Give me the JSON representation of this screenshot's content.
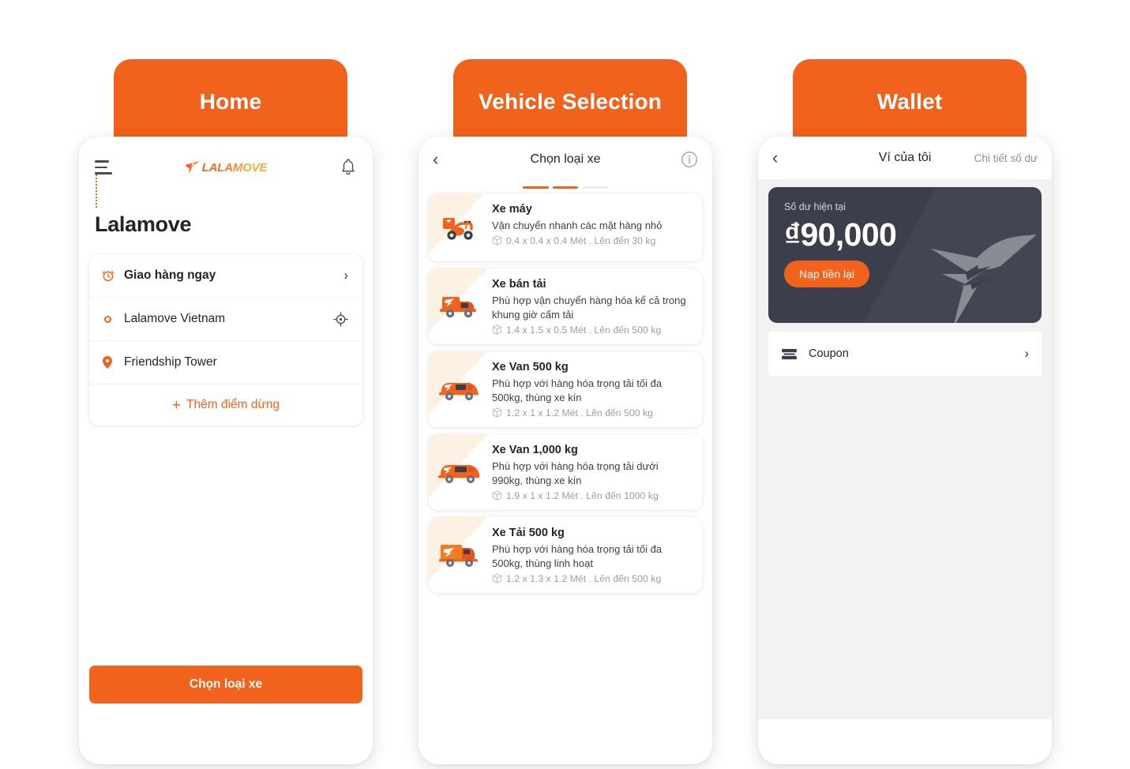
{
  "screens": [
    {
      "tab_label": "Home",
      "topbar": {
        "menu_icon": "hamburger-icon",
        "logo_text": "LALAMOVE",
        "notification_icon": "bell-icon"
      },
      "page_title": "Lalamove",
      "route": {
        "instant_label": "Giao hàng ngay",
        "pickup_label": "Lalamove Vietnam",
        "dropoff_label": "Friendship Tower",
        "add_stop_label": "Thêm điểm dừng",
        "add_stop_plus": "+",
        "chevron": "›",
        "clock_icon": "alarm-clock-icon",
        "locate_icon": "crosshair-target-icon",
        "pickup_icon": "circle-dot-icon",
        "dropoff_icon": "map-pin-icon"
      },
      "primary_button": "Chọn loại xe"
    },
    {
      "tab_label": "Vehicle Selection",
      "topbar": {
        "back_icon": "chevron-left-icon",
        "title": "Chọn loại xe",
        "info_icon": "info-circle-icon"
      },
      "progress_segments": [
        "on",
        "on",
        "off"
      ],
      "vehicles": [
        {
          "name": "Xe máy",
          "desc": "Vận chuyển nhanh các mặt hàng nhỏ",
          "spec": "0.4 x 0.4 x 0.4 Mét . Lên đến 30 kg",
          "icon": "motorbike-icon"
        },
        {
          "name": "Xe bán tải",
          "desc": "Phù hợp vận chuyển hàng hóa kể cả trong khung giờ cấm tải",
          "spec": "1.4 x 1.5 x 0.5 Mét . Lên đến 500 kg",
          "icon": "pickup-truck-icon"
        },
        {
          "name": "Xe Van 500 kg",
          "desc": "Phù hợp với hàng hóa trọng tải tối đa 500kg, thùng xe kín",
          "spec": "1.2 x 1 x 1.2 Mét . Lên đến 500 kg",
          "icon": "van-icon"
        },
        {
          "name": "Xe Van 1,000 kg",
          "desc": "Phù hợp với hàng hóa trọng tải dưới 990kg, thùng xe kín",
          "spec": "1.9 x 1 x 1.2 Mét . Lên đến 1000 kg",
          "icon": "van-large-icon"
        },
        {
          "name": "Xe Tải 500 kg",
          "desc": "Phù hợp với hàng hóa trọng tải tối đa 500kg, thùng linh hoạt",
          "spec": "1.2 x 1.3 x 1.2 Mét . Lên đến 500 kg",
          "icon": "box-truck-icon"
        }
      ]
    },
    {
      "tab_label": "Wallet",
      "topbar": {
        "back_icon": "chevron-left-icon",
        "title": "Ví của tôi",
        "detail_link": "Chi tiết số dư"
      },
      "balance": {
        "label": "Số dư hiện tại",
        "amount": "₫90,000",
        "topup_button": "Nạp tiền lại",
        "watermark_icon": "hummingbird-logo-icon"
      },
      "coupon": {
        "label": "Coupon",
        "icon": "ticket-icon",
        "chevron": "›"
      }
    }
  ],
  "colors": {
    "brand_orange": "#f1621c",
    "card_dark": "#3d3e4c",
    "page_bg": "#ffffff",
    "wallet_bg": "#f2f2f2",
    "muted_text": "#9b9ea1"
  }
}
